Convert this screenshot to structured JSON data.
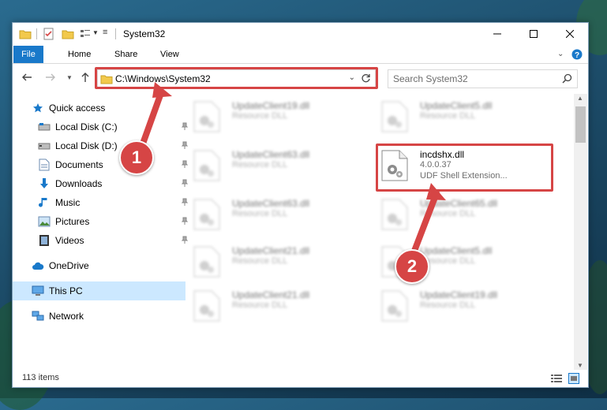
{
  "window": {
    "title": "System32"
  },
  "ribbon": {
    "tabs": [
      "File",
      "Home",
      "Share",
      "View"
    ]
  },
  "address": {
    "path": "C:\\Windows\\System32"
  },
  "search": {
    "placeholder": "Search System32"
  },
  "sidebar": {
    "quick_access": "Quick access",
    "items": [
      {
        "label": "Local Disk (C:)",
        "icon": "hdd-icon"
      },
      {
        "label": "Local Disk (D:)",
        "icon": "hdd-icon"
      },
      {
        "label": "Documents",
        "icon": "documents-icon"
      },
      {
        "label": "Downloads",
        "icon": "downloads-icon"
      },
      {
        "label": "Music",
        "icon": "music-icon"
      },
      {
        "label": "Pictures",
        "icon": "pictures-icon"
      },
      {
        "label": "Videos",
        "icon": "videos-icon"
      }
    ],
    "onedrive": "OneDrive",
    "this_pc": "This PC",
    "network": "Network"
  },
  "files": [
    {
      "name": "UpdateClient19.dll",
      "type": "Resource DLL"
    },
    {
      "name": "UpdateClient5.dll",
      "type": "Resource DLL"
    },
    {
      "name": "UpdateClient63.dll",
      "type": "Resource DLL"
    },
    {
      "name": "incdshx.dll",
      "version": "4.0.0.37",
      "type": "UDF Shell Extension..."
    },
    {
      "name": "UpdateClient63.dll",
      "type": "Resource DLL"
    },
    {
      "name": "UpdateClient65.dll",
      "type": "Resource DLL"
    },
    {
      "name": "UpdateClient21.dll",
      "type": "Resource DLL"
    },
    {
      "name": "UpdateClient5.dll",
      "type": "Resource DLL"
    },
    {
      "name": "UpdateClient21.dll",
      "type": "Resource DLL"
    },
    {
      "name": "UpdateClient19.dll",
      "type": "Resource DLL"
    }
  ],
  "status": {
    "items": "113 items"
  },
  "callouts": {
    "step1": "1",
    "step2": "2"
  },
  "colors": {
    "accent": "#1979ca",
    "highlight": "#d64545",
    "selected": "#cce8ff"
  }
}
